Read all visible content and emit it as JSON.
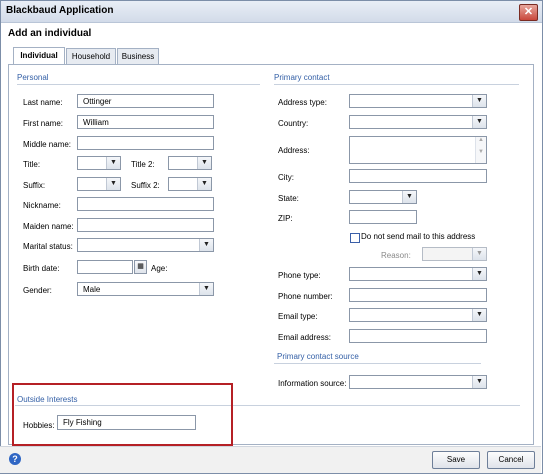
{
  "window": {
    "title": "Blackbaud Application",
    "close_icon": "close-icon"
  },
  "form": {
    "heading": "Add an individual"
  },
  "tabs": [
    {
      "label": "Individual",
      "active": true
    },
    {
      "label": "Household",
      "active": false
    },
    {
      "label": "Business",
      "active": false
    }
  ],
  "personal": {
    "section_title": "Personal",
    "last_name_label": "Last name:",
    "last_name_value": "Ottinger",
    "first_name_label": "First name:",
    "first_name_value": "William",
    "middle_name_label": "Middle name:",
    "middle_name_value": "",
    "title_label": "Title:",
    "title_value": "",
    "title2_label": "Title 2:",
    "title2_value": "",
    "suffix_label": "Suffix:",
    "suffix_value": "",
    "suffix2_label": "Suffix 2:",
    "suffix2_value": "",
    "nickname_label": "Nickname:",
    "nickname_value": "",
    "maiden_name_label": "Maiden name:",
    "maiden_name_value": "",
    "marital_status_label": "Marital status:",
    "marital_status_value": "",
    "birth_date_label": "Birth date:",
    "birth_date_value": "",
    "age_label": "Age:",
    "gender_label": "Gender:",
    "gender_value": "Male"
  },
  "primary_contact": {
    "section_title": "Primary contact",
    "address_type_label": "Address type:",
    "address_type_value": "",
    "country_label": "Country:",
    "country_value": "",
    "address_label": "Address:",
    "address_value": "",
    "city_label": "City:",
    "city_value": "",
    "state_label": "State:",
    "state_value": "",
    "zip_label": "ZIP:",
    "zip_value": "",
    "no_mail_label": "Do not send mail to this address",
    "no_mail_checked": false,
    "reason_label": "Reason:",
    "reason_value": "",
    "phone_type_label": "Phone type:",
    "phone_type_value": "",
    "phone_number_label": "Phone number:",
    "phone_number_value": "",
    "email_type_label": "Email type:",
    "email_type_value": "",
    "email_address_label": "Email address:",
    "email_address_value": ""
  },
  "primary_contact_source": {
    "section_title": "Primary contact source",
    "information_source_label": "Information source:",
    "information_source_value": ""
  },
  "outside_interests": {
    "section_title": "Outside Interests",
    "hobbies_label": "Hobbies:",
    "hobbies_value": "Fly Fishing"
  },
  "footer": {
    "help_icon": "help-icon",
    "save_label": "Save",
    "cancel_label": "Cancel"
  },
  "colors": {
    "section_title": "#335fa6",
    "highlight_border": "#b52025"
  }
}
